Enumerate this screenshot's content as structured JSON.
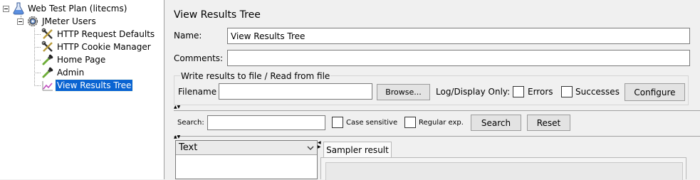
{
  "tree": {
    "items": [
      {
        "label": "Web Test Plan (litecms)",
        "icon": "test-plan-icon"
      },
      {
        "label": "JMeter Users",
        "icon": "thread-group-gear-icon"
      },
      {
        "label": "HTTP Request Defaults",
        "icon": "config-wrench-icon"
      },
      {
        "label": "HTTP Cookie Manager",
        "icon": "config-wrench-icon"
      },
      {
        "label": "Home Page",
        "icon": "sampler-pipette-icon"
      },
      {
        "label": "Admin",
        "icon": "sampler-pipette-icon"
      },
      {
        "label": "View Results Tree",
        "icon": "listener-chart-icon",
        "selected": true
      }
    ]
  },
  "panel": {
    "title": "View Results Tree",
    "name_label": "Name:",
    "name_value": "View Results Tree",
    "comments_label": "Comments:",
    "comments_value": "",
    "file_group_title": "Write results to file / Read from file",
    "filename_label": "Filename",
    "filename_value": "",
    "browse_label": "Browse...",
    "log_display_label": "Log/Display Only:",
    "errors_label": "Errors",
    "successes_label": "Successes",
    "configure_label": "Configure"
  },
  "search": {
    "label": "Search:",
    "value": "",
    "case_sensitive_label": "Case sensitive",
    "regular_exp_label": "Regular exp.",
    "search_button": "Search",
    "reset_button": "Reset"
  },
  "results": {
    "renderer_selected": "Text",
    "tab_sampler_result": "Sampler result"
  },
  "colors": {
    "selection": "#0a64d2",
    "background": "#f0f0f0"
  }
}
